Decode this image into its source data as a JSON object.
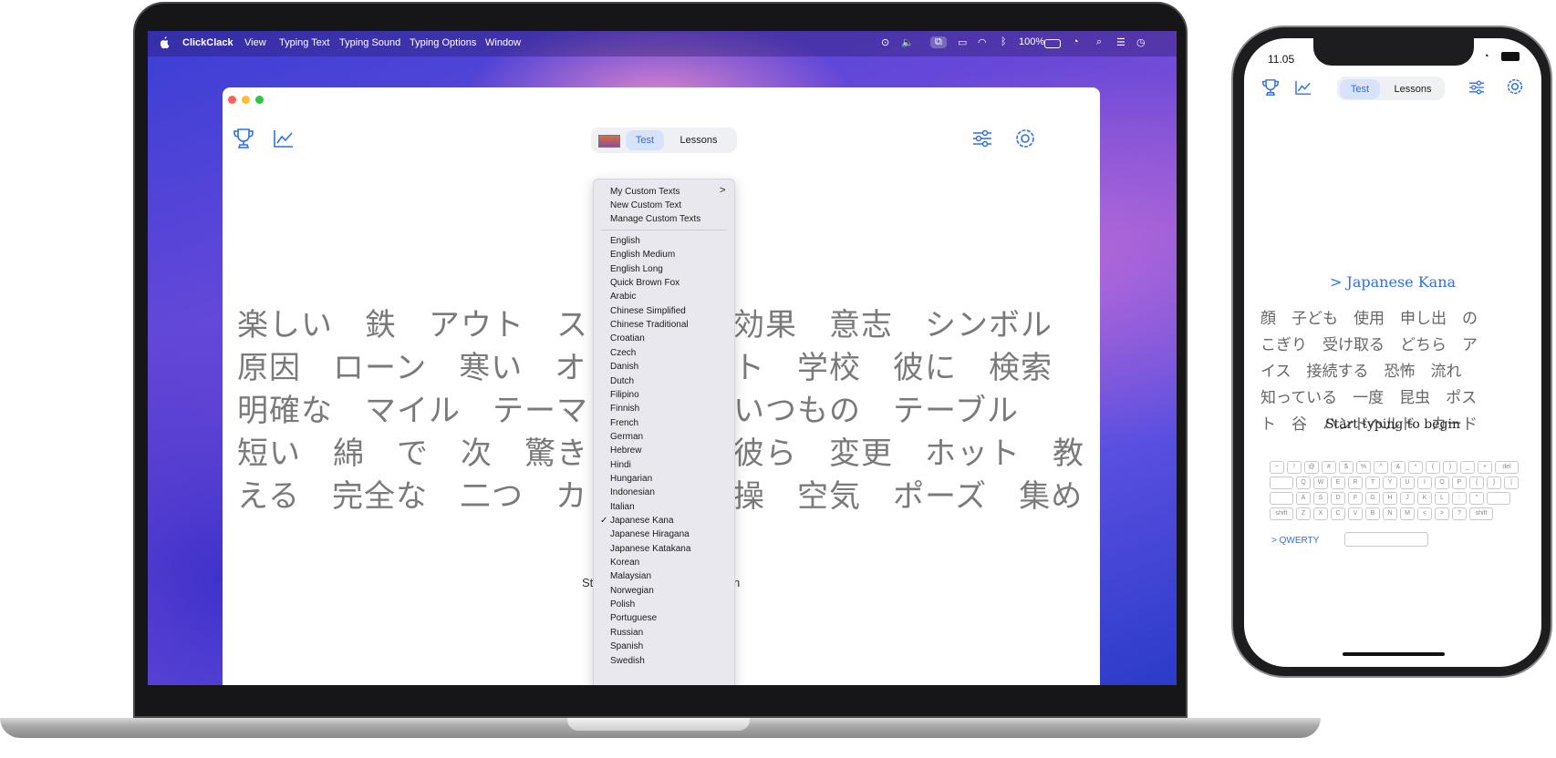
{
  "mac": {
    "menubar": {
      "app": "ClickClack",
      "items": [
        "View",
        "Typing Text",
        "Typing Sound",
        "Typing Options",
        "Window"
      ],
      "battery": "100%"
    },
    "tabs": {
      "test": "Test",
      "lessons": "Lessons"
    },
    "menu": {
      "custom_items": [
        "My Custom Texts",
        "New Custom Text",
        "Manage Custom Texts"
      ],
      "languages": [
        "English",
        "English Medium",
        "English Long",
        "Quick Brown Fox",
        "Arabic",
        "Chinese Simplified",
        "Chinese Traditional",
        "Croatian",
        "Czech",
        "Danish",
        "Dutch",
        "Filipino",
        "Finnish",
        "French",
        "German",
        "Hebrew",
        "Hindi",
        "Hungarian",
        "Indonesian",
        "Italian",
        "Japanese Kana",
        "Japanese Hiragana",
        "Japanese Katakana",
        "Korean",
        "Malaysian",
        "Norwegian",
        "Polish",
        "Portuguese",
        "Russian",
        "Spanish",
        "Swedish"
      ],
      "selected": "Japanese Kana",
      "submenu_arrow": ">",
      "check": "✓"
    },
    "typing_lines": [
      "楽しい　鉄　アウト　ス",
      "原因　ローン　寒い　オ",
      "明確な　マイル　テーマ",
      "短い　綿　で　次　驚き",
      "える　完全な　二つ　カ"
    ],
    "typing_lines_right": [
      "効果　意志　シンボル",
      "ト　学校　彼に　検索",
      "いつもの　テーブル",
      "彼ら　変更　ホット　教",
      "操　空気　ポーズ　集め"
    ],
    "start_left": "St",
    "start_right": "n"
  },
  "phone": {
    "time": "11.05",
    "tabs": {
      "test": "Test",
      "lessons": "Lessons"
    },
    "title": "> Japanese Kana",
    "text_lines": [
      "顔　子ども　使用　申し出　の",
      "こぎり　受け取る　どちら　ア",
      "イス　接続する　恐怖　流れ",
      "知っている　一度　昆虫　ポス",
      "ト　谷　ハンドヘルド　カード"
    ],
    "start": "Start typing to begin",
    "layout": "> QWERTY",
    "keyboard": {
      "row1": [
        "~",
        "!",
        "@",
        "#",
        "$",
        "%",
        "^",
        "&",
        "*",
        "(",
        ")",
        "_",
        "+",
        "del"
      ],
      "row2": [
        "",
        "Q",
        "W",
        "E",
        "R",
        "T",
        "Y",
        "U",
        "I",
        "O",
        "P",
        "{",
        "}",
        "|"
      ],
      "row3": [
        "",
        "A",
        "S",
        "D",
        "F",
        "G",
        "H",
        "J",
        "K",
        "L",
        ":",
        "\"",
        ""
      ],
      "row4": [
        "shift",
        "Z",
        "X",
        "C",
        "V",
        "B",
        "N",
        "M",
        "<",
        ">",
        "?",
        "shift"
      ]
    }
  }
}
